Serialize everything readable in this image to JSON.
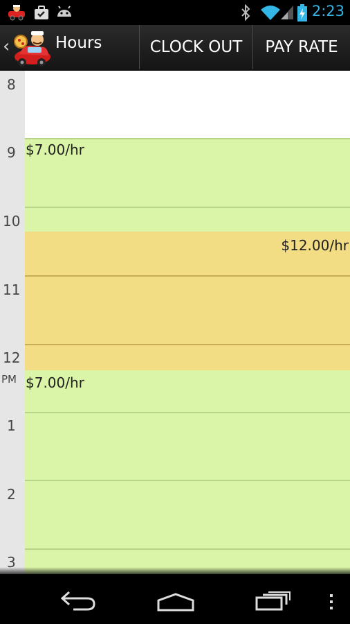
{
  "status_bar": {
    "time": "2:23",
    "left_icons": [
      "pizza-app-notification-icon",
      "briefcase-notification-icon",
      "android-debug-icon"
    ],
    "right_icons": [
      "bluetooth-icon",
      "wifi-icon",
      "cell-signal-icon",
      "battery-charging-icon"
    ],
    "accent_color": "#33b5e5"
  },
  "action_bar": {
    "title": "Hours",
    "actions": [
      "CLOCK OUT",
      "PAY RATE"
    ]
  },
  "calendar": {
    "hours": [
      "8",
      "9",
      "10",
      "11",
      "12",
      "1",
      "2",
      "3"
    ],
    "pm_marker": "PM",
    "rates": [
      {
        "label": "$7.00/hr",
        "color": "#dbf5a8"
      },
      {
        "label": "$12.00/hr",
        "color": "#f2dc84"
      },
      {
        "label": "$7.00/hr",
        "color": "#dbf5a8"
      }
    ]
  },
  "nav_bar": {
    "buttons": [
      "back-icon",
      "home-icon",
      "recent-apps-icon",
      "overflow-menu-icon"
    ]
  }
}
